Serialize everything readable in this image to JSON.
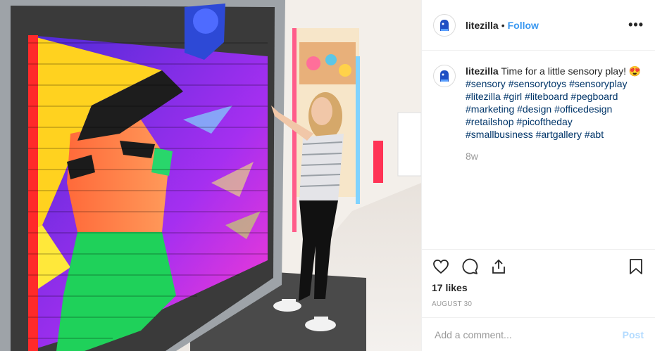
{
  "post": {
    "username": "litezilla",
    "separator": "•",
    "follow_label": "Follow",
    "more_icon": "more-horizontal-icon",
    "caption_text": "Time for a little sensory play!",
    "caption_emoji": "😍",
    "hashtags": "#sensory #sensorytoys #sensoryplay #litezilla #girl #liteboard #pegboard #marketing #design #officedesign #retailshop #picoftheday #smallbusiness #artgallery #abt",
    "time_ago": "8w",
    "likes": "17 likes",
    "date": "AUGUST 30",
    "comment_placeholder": "Add a comment...",
    "post_label": "Post",
    "colors": {
      "link": "#3897f0",
      "hashtag": "#003569",
      "muted": "#999999",
      "post_disabled": "#b3dbff"
    }
  }
}
